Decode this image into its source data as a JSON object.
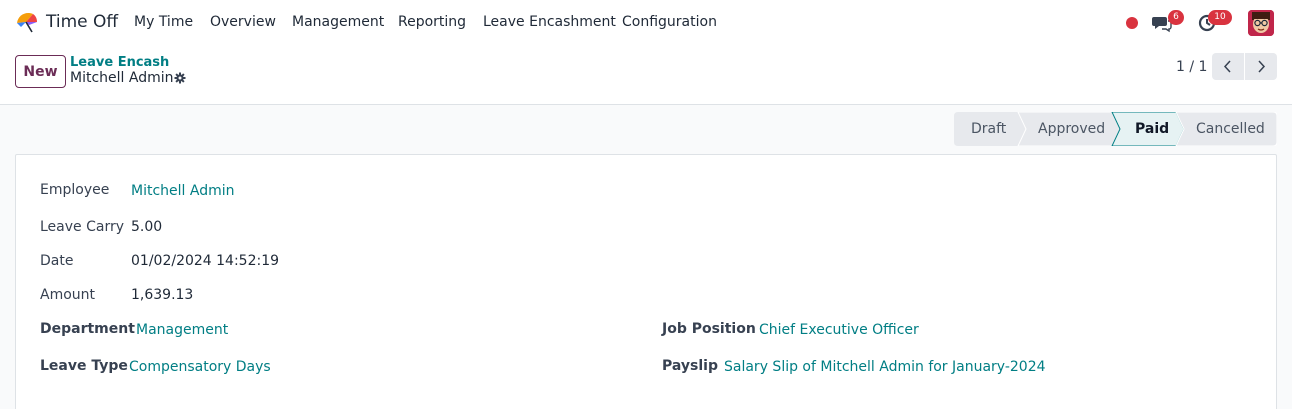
{
  "app": {
    "name": "Time Off",
    "logo_icon": "time-off-umbrella-logo"
  },
  "menu": {
    "items": [
      "My Time",
      "Overview",
      "Management",
      "Reporting",
      "Leave Encashment",
      "Configuration"
    ]
  },
  "systray": {
    "messages_count": "6",
    "activities_count": "10",
    "colors": {
      "badge": "#d9333f",
      "recording_dot": "#d9333f"
    }
  },
  "control_panel": {
    "new_label": "New",
    "breadcrumb_parent": "Leave Encash",
    "breadcrumb_current": "Mitchell Admin",
    "pager": "1 / 1"
  },
  "statusbar": {
    "stages": [
      "Draft",
      "Approved",
      "Paid",
      "Cancelled"
    ],
    "active": "Paid",
    "colors": {
      "active_bg": "#e6f2f3",
      "active_border": "#017e84",
      "inactive_bg": "#e7e9ed"
    }
  },
  "form": {
    "employee": {
      "label": "Employee",
      "value": "Mitchell Admin"
    },
    "leave_carry": {
      "label": "Leave Carry",
      "value": "5.00"
    },
    "date": {
      "label": "Date",
      "value": "01/02/2024 14:52:19"
    },
    "amount": {
      "label": "Amount",
      "value": "1,639.13"
    },
    "department": {
      "label": "Department",
      "value": "Management"
    },
    "leave_type": {
      "label": "Leave Type",
      "value": "Compensatory Days"
    },
    "job_position": {
      "label": "Job Position",
      "value": "Chief Executive Officer"
    },
    "payslip": {
      "label": "Payslip",
      "value": "Salary Slip of Mitchell Admin for January-2024"
    }
  },
  "colors": {
    "link": "#017e84",
    "brand": "#6b2c56"
  }
}
